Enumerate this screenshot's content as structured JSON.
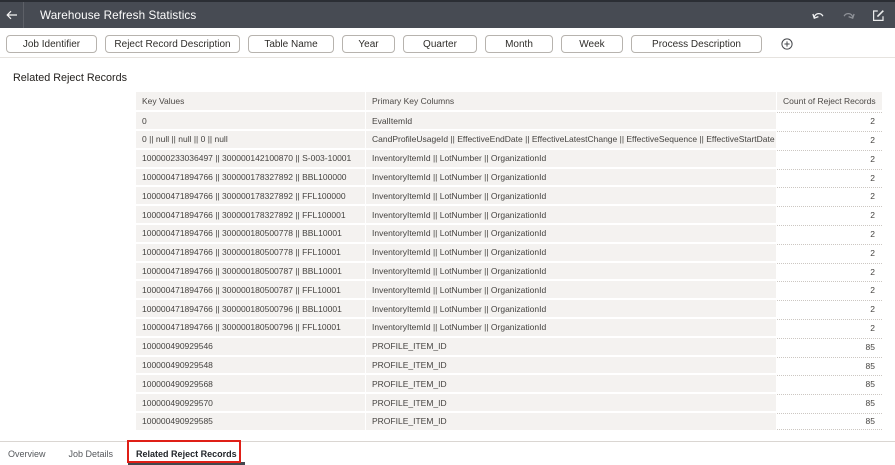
{
  "colors": {
    "topbar_bg": "#474b53",
    "topbar_top_strip": "#2b2e34",
    "table_cell_bg": "#f4f2f0",
    "active_tab_underline": "#43474e",
    "annotation_red": "#df1f17"
  },
  "topbar": {
    "title": "Warehouse Refresh Statistics",
    "back_icon": "arrow-left-icon",
    "undo_icon": "undo-icon",
    "redo_icon": "redo-icon",
    "edit_icon": "edit-icon"
  },
  "filter_bar": {
    "chips": [
      "Job Identifier",
      "Reject Record Description",
      "Table Name",
      "Year",
      "Quarter",
      "Month",
      "Week",
      "Process Description"
    ],
    "add_filter_icon": "plus-circle-icon"
  },
  "section": {
    "title": "Related Reject Records"
  },
  "table": {
    "columns": [
      "Key Values",
      "Primary Key Columns",
      "Count of Reject Records"
    ],
    "rows": [
      [
        "0",
        "EvalItemId",
        "2"
      ],
      [
        "0 || null || null || 0 || null",
        "CandProfileUsageId || EffectiveEndDate || EffectiveLatestChange || EffectiveSequence || EffectiveStartDate",
        "2"
      ],
      [
        "100000233036497 || 300000142100870 || S-003-10001",
        "InventoryItemId || LotNumber || OrganizationId",
        "2"
      ],
      [
        "100000471894766 || 300000178327892 || BBL100000",
        "InventoryItemId || LotNumber || OrganizationId",
        "2"
      ],
      [
        "100000471894766 || 300000178327892 || FFL100000",
        "InventoryItemId || LotNumber || OrganizationId",
        "2"
      ],
      [
        "100000471894766 || 300000178327892 || FFL100001",
        "InventoryItemId || LotNumber || OrganizationId",
        "2"
      ],
      [
        "100000471894766 || 300000180500778 || BBL10001",
        "InventoryItemId || LotNumber || OrganizationId",
        "2"
      ],
      [
        "100000471894766 || 300000180500778 || FFL10001",
        "InventoryItemId || LotNumber || OrganizationId",
        "2"
      ],
      [
        "100000471894766 || 300000180500787 || BBL10001",
        "InventoryItemId || LotNumber || OrganizationId",
        "2"
      ],
      [
        "100000471894766 || 300000180500787 || FFL10001",
        "InventoryItemId || LotNumber || OrganizationId",
        "2"
      ],
      [
        "100000471894766 || 300000180500796 || BBL10001",
        "InventoryItemId || LotNumber || OrganizationId",
        "2"
      ],
      [
        "100000471894766 || 300000180500796 || FFL10001",
        "InventoryItemId || LotNumber || OrganizationId",
        "2"
      ],
      [
        "100000490929546",
        "PROFILE_ITEM_ID",
        "85"
      ],
      [
        "100000490929548",
        "PROFILE_ITEM_ID",
        "85"
      ],
      [
        "100000490929568",
        "PROFILE_ITEM_ID",
        "85"
      ],
      [
        "100000490929570",
        "PROFILE_ITEM_ID",
        "85"
      ],
      [
        "100000490929585",
        "PROFILE_ITEM_ID",
        "85"
      ]
    ]
  },
  "footer_tabs": {
    "tabs": [
      {
        "label": "Overview",
        "active": false
      },
      {
        "label": "Job Details",
        "active": false
      },
      {
        "label": "Related Reject Records",
        "active": true
      }
    ],
    "annotation": "red-rectangle-highlight"
  }
}
